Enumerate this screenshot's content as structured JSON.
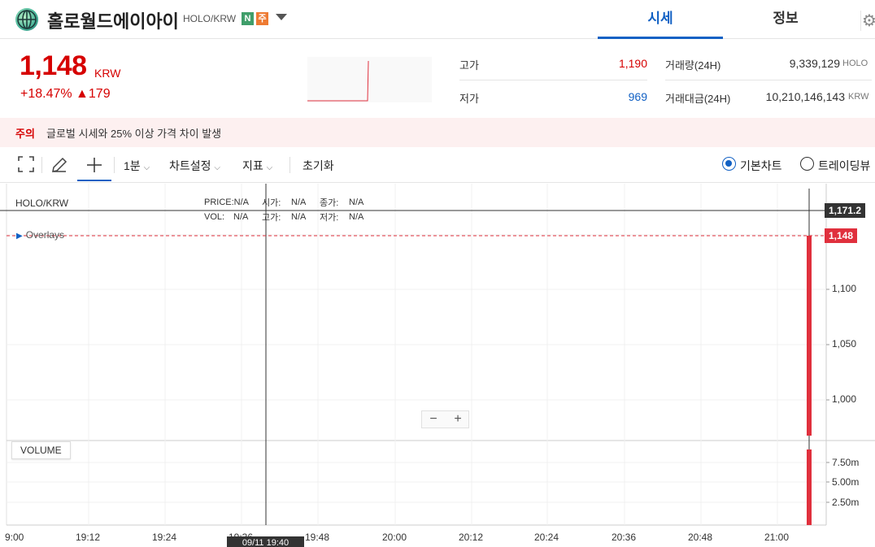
{
  "header": {
    "coin_name": "홀로월드에이아이",
    "pair": "HOLO/KRW",
    "badge_n": "N",
    "badge_j": "주",
    "tabs": [
      {
        "label": "시세"
      },
      {
        "label": "정보"
      }
    ]
  },
  "price": {
    "current": "1,148",
    "unit": "KRW",
    "change": "+18.47% ▲179"
  },
  "stats": {
    "high_label": "고가",
    "high_value": "1,190",
    "low_label": "저가",
    "low_value": "969",
    "vol_label": "거래량(24H)",
    "vol_value": "9,339,129",
    "vol_unit": "HOLO",
    "amt_label": "거래대금(24H)",
    "amt_value": "10,210,146,143",
    "amt_unit": "KRW"
  },
  "warning": {
    "tag": "주의",
    "text": "글로벌 시세와 25% 이상 가격 차이 발생"
  },
  "toolbar": {
    "interval": "1분",
    "chart_settings": "차트설정",
    "indicators": "지표",
    "reset": "초기화",
    "basic_chart": "기본차트",
    "tradingview": "트레이딩뷰"
  },
  "chart": {
    "pair_label": "HOLO/KRW",
    "price_label": "PRICE:N/A",
    "open_label": "시가:",
    "open_value": "N/A",
    "close_label": "종가:",
    "close_value": "N/A",
    "vol_label": "VOL:",
    "vol_value": "N/A",
    "high_label": "고가:",
    "high_value": "N/A",
    "low_label": "저가:",
    "low_value": "N/A",
    "overlays": "Overlays",
    "crosshair_price": "1,171.2",
    "last_price": "1,148",
    "yticks": [
      "1,100",
      "1,050",
      "1,000"
    ],
    "vol_ticks": [
      "7.50m",
      "5.00m",
      "2.50m"
    ],
    "xticks": [
      "9:00",
      "19:12",
      "19:24",
      "19:36",
      "19:48",
      "20:00",
      "20:12",
      "20:24",
      "20:36",
      "20:48",
      "21:00"
    ],
    "crosshair_time": "09/11 19:40",
    "volume_label": "VOLUME",
    "zoom_out": "−",
    "zoom_in": "+",
    "accent": "#e0303d"
  }
}
